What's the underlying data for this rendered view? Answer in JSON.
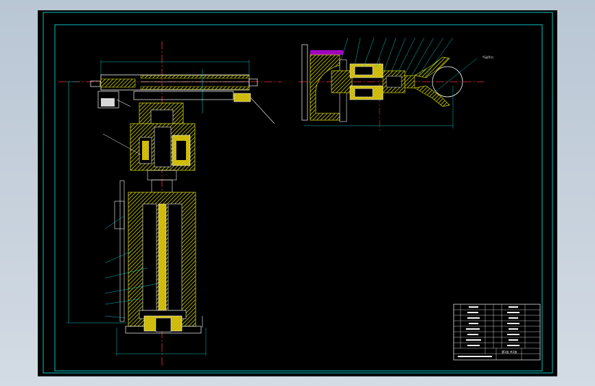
{
  "colors": {
    "background": "#000000",
    "border": "#00c8c8",
    "outline": "#ffffff",
    "center_line": "#ff3030",
    "hatch_yellow": "#d8d800",
    "section_fill": "#c8b400",
    "purple": "#a000c0"
  },
  "drawing": {
    "callout_label": "气动手爪"
  },
  "title_block": {
    "rows": 8,
    "note": "第1张 共3张"
  }
}
